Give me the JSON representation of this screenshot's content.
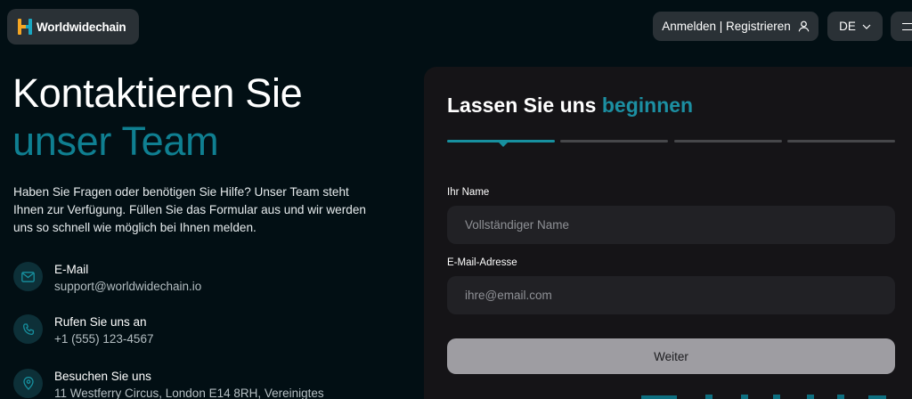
{
  "header": {
    "logo_text": "Worldwidechain",
    "login_label": "Anmelden | Registrieren",
    "language": "DE"
  },
  "hero": {
    "title_line1": "Kontaktieren Sie",
    "title_line2": "unser Team",
    "description": "Haben Sie Fragen oder benötigen Sie Hilfe? Unser Team steht Ihnen zur Verfügung. Füllen Sie das Formular aus und wir werden uns so schnell wie möglich bei Ihnen melden."
  },
  "contacts": [
    {
      "label": "E-Mail",
      "value": "support@worldwidechain.io",
      "icon": "mail-icon"
    },
    {
      "label": "Rufen Sie uns an",
      "value": "+1 (555) 123-4567",
      "icon": "phone-icon"
    },
    {
      "label": "Besuchen Sie uns",
      "value": "11 Westferry Circus, London E14 8RH, Vereinigtes",
      "icon": "map-pin-icon"
    }
  ],
  "form": {
    "title_plain": "Lassen Sie uns",
    "title_accent": "beginnen",
    "steps_total": 4,
    "active_step": 1,
    "name_label": "Ihr Name",
    "name_placeholder": "Vollständiger Name",
    "email_label": "E-Mail-Adresse",
    "email_placeholder": "ihre@email.com",
    "submit_label": "Weiter"
  },
  "colors": {
    "background": "#020f14",
    "accent": "#0f7f91",
    "card": "#151417",
    "input": "#212125",
    "button_disabled": "#9e9da2"
  }
}
